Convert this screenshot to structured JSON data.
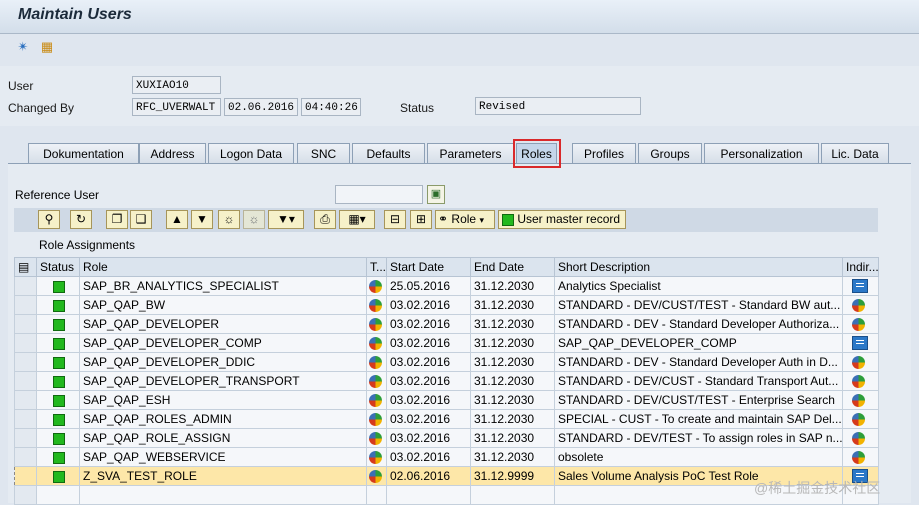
{
  "window": {
    "title": "Maintain Users"
  },
  "header": {
    "user_label": "User",
    "user_value": "XUXIAO10",
    "changed_by_label": "Changed By",
    "changed_by_value": "RFC_UVERWALT",
    "changed_date": "02.06.2016",
    "changed_time": "04:40:26",
    "status_label": "Status",
    "status_value": "Revised"
  },
  "tabs": [
    "Dokumentation",
    "Address",
    "Logon Data",
    "SNC",
    "Defaults",
    "Parameters",
    "Roles",
    "Profiles",
    "Groups",
    "Personalization",
    "Lic. Data"
  ],
  "active_tab": "Roles",
  "reference_user": {
    "label": "Reference User",
    "value": ""
  },
  "grid_toolbar": {
    "role_button": "Role",
    "user_master_button": "User master record"
  },
  "role_assignments": {
    "title": "Role Assignments",
    "columns": [
      "Status",
      "Role",
      "T...",
      "Start Date",
      "End Date",
      "Short Description",
      "Indir..."
    ],
    "rows": [
      {
        "role": "SAP_BR_ANALYTICS_SPECIALIST",
        "start": "25.05.2016",
        "end": "31.12.2030",
        "desc": "Analytics Specialist",
        "indirect": "doc"
      },
      {
        "role": "SAP_QAP_BW",
        "start": "03.02.2016",
        "end": "31.12.2030",
        "desc": "STANDARD - DEV/CUST/TEST - Standard BW aut...",
        "indirect": "pie"
      },
      {
        "role": "SAP_QAP_DEVELOPER",
        "start": "03.02.2016",
        "end": "31.12.2030",
        "desc": "STANDARD - DEV - Standard Developer Authoriza...",
        "indirect": "pie"
      },
      {
        "role": "SAP_QAP_DEVELOPER_COMP",
        "start": "03.02.2016",
        "end": "31.12.2030",
        "desc": "SAP_QAP_DEVELOPER_COMP",
        "indirect": "doc"
      },
      {
        "role": "SAP_QAP_DEVELOPER_DDIC",
        "start": "03.02.2016",
        "end": "31.12.2030",
        "desc": "STANDARD - DEV - Standard Developer Auth in D...",
        "indirect": "pie"
      },
      {
        "role": "SAP_QAP_DEVELOPER_TRANSPORT",
        "start": "03.02.2016",
        "end": "31.12.2030",
        "desc": "STANDARD - DEV/CUST - Standard Transport Aut...",
        "indirect": "pie"
      },
      {
        "role": "SAP_QAP_ESH",
        "start": "03.02.2016",
        "end": "31.12.2030",
        "desc": "STANDARD - DEV/CUST/TEST - Enterprise Search",
        "indirect": "pie"
      },
      {
        "role": "SAP_QAP_ROLES_ADMIN",
        "start": "03.02.2016",
        "end": "31.12.2030",
        "desc": "SPECIAL - CUST - To create and maintain SAP Del...",
        "indirect": "pie"
      },
      {
        "role": "SAP_QAP_ROLE_ASSIGN",
        "start": "03.02.2016",
        "end": "31.12.2030",
        "desc": "STANDARD - DEV/TEST - To assign roles in SAP n...",
        "indirect": "pie"
      },
      {
        "role": "SAP_QAP_WEBSERVICE",
        "start": "03.02.2016",
        "end": "31.12.2030",
        "desc": "obsolete",
        "indirect": "pie"
      },
      {
        "role": "Z_SVA_TEST_ROLE",
        "start": "02.06.2016",
        "end": "31.12.9999",
        "desc": "Sales Volume Analysis PoC Test Role",
        "indirect": "doc",
        "selected": true
      }
    ]
  },
  "watermark": "@稀土掘金技术社区"
}
